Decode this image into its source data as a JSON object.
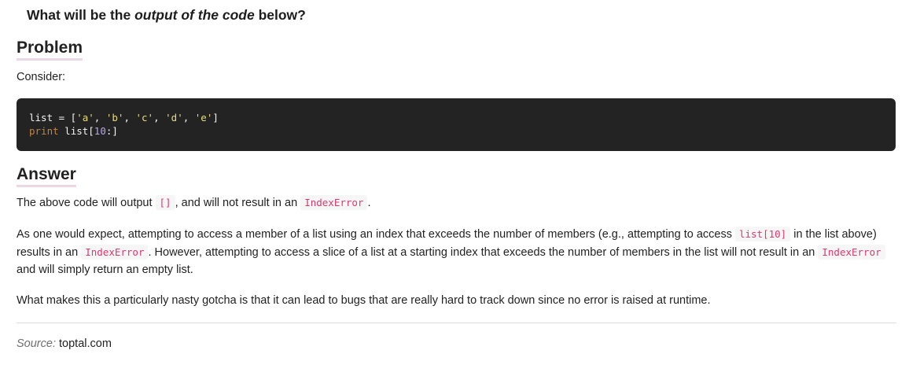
{
  "question": {
    "prefix": "What will be the ",
    "emphasis": "output of the code",
    "suffix": " below?"
  },
  "problem": {
    "heading": "Problem",
    "intro": "Consider:",
    "code": {
      "line1": {
        "text_a": "list = [",
        "s1": "'a'",
        "c1": ", ",
        "s2": "'b'",
        "c2": ", ",
        "s3": "'c'",
        "c3": ", ",
        "s4": "'d'",
        "c4": ", ",
        "s5": "'e'",
        "end": "]"
      },
      "line2": {
        "keyword": "print",
        "text_a": " list[",
        "number": "10",
        "end": ":]"
      }
    }
  },
  "answer": {
    "heading": "Answer",
    "p1": {
      "t1": "The above code will output ",
      "code1": "[]",
      "t2": ", and will not result in an ",
      "code2": "IndexError",
      "t3": "."
    },
    "p2": {
      "t1": "As one would expect, attempting to access a member of a list using an index that exceeds the number of members (e.g., attempting to access ",
      "code1": "list[10]",
      "t2": " in the list above) results in an ",
      "code2": "IndexError",
      "t3": ". However, attempting to access a slice of a list at a starting index that exceeds the number of members in the list will not result in an ",
      "code3": "IndexError",
      "t4": " and will simply return an empty list."
    },
    "p3": "What makes this a particularly nasty gotcha is that it can lead to bugs that are really hard to track down since no error is raised at runtime."
  },
  "source": {
    "label": "Source:",
    "site": "toptal.com"
  },
  "colors": {
    "code_background": "#232323",
    "inline_code_text": "#e0366c",
    "heading_underline": "#ead7e7"
  }
}
